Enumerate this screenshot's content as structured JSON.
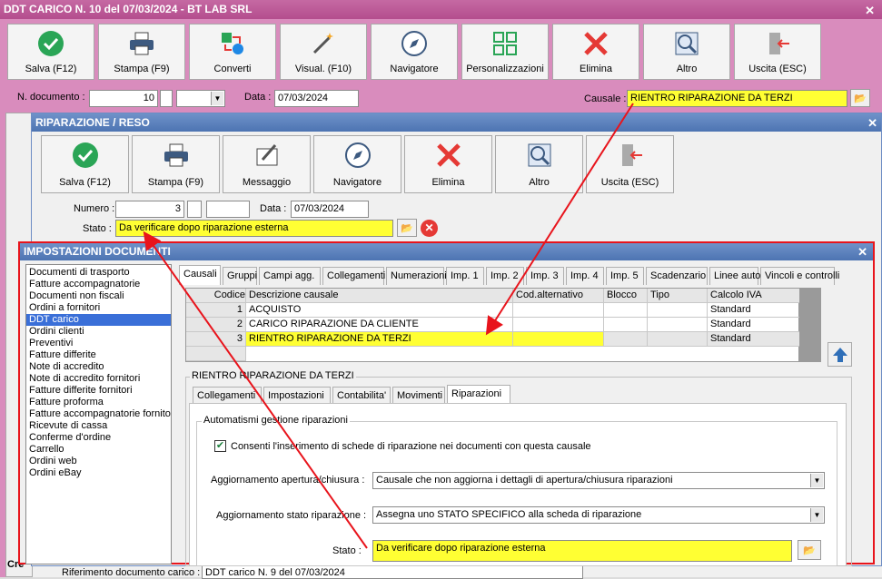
{
  "main_window": {
    "title": "DDT CARICO N. 10 del 07/03/2024 - BT LAB SRL",
    "toolbar": [
      "Salva (F12)",
      "Stampa (F9)",
      "Converti",
      "Visual. (F10)",
      "Navigatore",
      "Personalizzazioni",
      "Elimina",
      "Altro",
      "Uscita (ESC)"
    ],
    "doc_number_label": "N. documento :",
    "doc_number": "10",
    "date_label": "Data :",
    "date": "07/03/2024",
    "causale_label": "Causale :",
    "causale": "RIENTRO RIPARAZIONE DA TERZI",
    "footer_label": "Riferimento documento carico :",
    "footer_value": "DDT carico N. 9 del 07/03/2024",
    "partial_left": "Cre"
  },
  "repair_window": {
    "title": "RIPARAZIONE / RESO",
    "toolbar": [
      "Salva (F12)",
      "Stampa (F9)",
      "Messaggio",
      "Navigatore",
      "Elimina",
      "Altro",
      "Uscita (ESC)"
    ],
    "numero_label": "Numero :",
    "numero": "3",
    "data_label": "Data :",
    "data": "07/03/2024",
    "stato_label": "Stato :",
    "stato": "Da verificare dopo riparazione esterna"
  },
  "settings_window": {
    "title": "IMPOSTAZIONI DOCUMENTI",
    "doc_types": [
      "Documenti di trasporto",
      "Fatture accompagnatorie",
      "Documenti non fiscali",
      "Ordini a fornitori",
      "DDT carico",
      "Ordini clienti",
      "Preventivi",
      "Fatture differite",
      "Note di accredito",
      "Note di accredito fornitori",
      "Fatture differite fornitori",
      "Fatture proforma",
      "Fatture accompagnatorie fornito",
      "Ricevute di cassa",
      "Conferme d'ordine",
      "Carrello",
      "Ordini web",
      "Ordini eBay"
    ],
    "selected_doc_type": "DDT carico",
    "tabs": [
      "Causali",
      "Gruppi",
      "Campi agg.",
      "Collegamenti",
      "Numerazioni",
      "Imp. 1",
      "Imp. 2",
      "Imp. 3",
      "Imp. 4",
      "Imp. 5",
      "Scadenzario",
      "Linee auto",
      "Vincoli e controlli"
    ],
    "grid_headers": [
      "Codice",
      "Descrizione causale",
      "Cod.alternativo",
      "Blocco",
      "Tipo",
      "Calcolo IVA"
    ],
    "grid_rows": [
      {
        "codice": "1",
        "descrizione": "ACQUISTO",
        "iva": "Standard"
      },
      {
        "codice": "2",
        "descrizione": "CARICO RIPARAZIONE DA CLIENTE",
        "iva": "Standard"
      },
      {
        "codice": "3",
        "descrizione": "RIENTRO RIPARAZIONE DA TERZI",
        "iva": "Standard"
      }
    ],
    "group_title": "RIENTRO RIPARAZIONE DA TERZI",
    "sub_tabs": [
      "Collegamenti",
      "Impostazioni",
      "Contabilita'",
      "Movimenti",
      "Riparazioni"
    ],
    "automatismi_title": "Automatismi gestione riparazioni",
    "checkbox_label": "Consenti l'inserimento di schede di riparazione nei documenti con questa causale",
    "apertura_label": "Aggiornamento apertura/chiusura :",
    "apertura_value": "Causale che non aggiorna i dettagli di apertura/chiusura riparazioni",
    "stato_rip_label": "Aggiornamento stato riparazione :",
    "stato_rip_value": "Assegna uno STATO SPECIFICO alla scheda di riparazione",
    "stato_label": "Stato :",
    "stato_value": "Da verificare dopo riparazione esterna"
  },
  "colors": {
    "main_bg": "#d98cbd",
    "title_pink": "#c0579a",
    "title_blue": "#5a7fb8",
    "highlight_red": "#e8141c",
    "yellow": "#ffff33",
    "selection": "#3a6fd8"
  }
}
